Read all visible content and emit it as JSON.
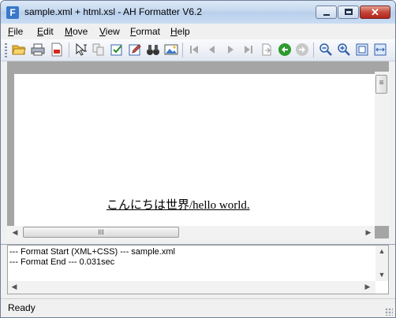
{
  "window": {
    "title": "sample.xml + html.xsl - AH Formatter V6.2",
    "app_icon_glyph": "F",
    "close_glyph": "✕"
  },
  "menu": [
    {
      "label_ul": "F",
      "label_rest": "ile"
    },
    {
      "label_ul": "E",
      "label_rest": "dit"
    },
    {
      "label_ul": "M",
      "label_rest": "ove"
    },
    {
      "label_ul": "V",
      "label_rest": "iew"
    },
    {
      "label_ul": "F",
      "label_rest": "ormat"
    },
    {
      "label_ul": "H",
      "label_rest": "elp"
    }
  ],
  "toolbar": {
    "icons": [
      "open-folder-icon",
      "print-icon",
      "pdf-icon",
      "select-pointer-icon",
      "copy-icon",
      "edit-check-icon",
      "edit-pencil-icon",
      "find-binoculars-icon",
      "gallery-icon",
      "first-page-icon",
      "prev-page-icon",
      "next-page-icon",
      "last-page-icon",
      "go-to-page-icon",
      "back-icon",
      "forward-icon",
      "zoom-out-icon",
      "zoom-in-icon",
      "fit-page-icon",
      "fit-width-icon"
    ],
    "accent_green": "#2e9b2e"
  },
  "document": {
    "text_jp": "こんにちは世界",
    "text_en": "/hello world."
  },
  "scrollbars": {
    "h_thumb_glyph": "III",
    "v_thumb_glyph": "≡",
    "left_arrow": "◀",
    "right_arrow": "▶",
    "up_arrow": "▲",
    "down_arrow": "▼"
  },
  "log": {
    "lines": [
      "--- Format Start (XML+CSS) --- sample.xml",
      "--- Format End ---  0.031sec"
    ]
  },
  "status": {
    "text": "Ready"
  }
}
